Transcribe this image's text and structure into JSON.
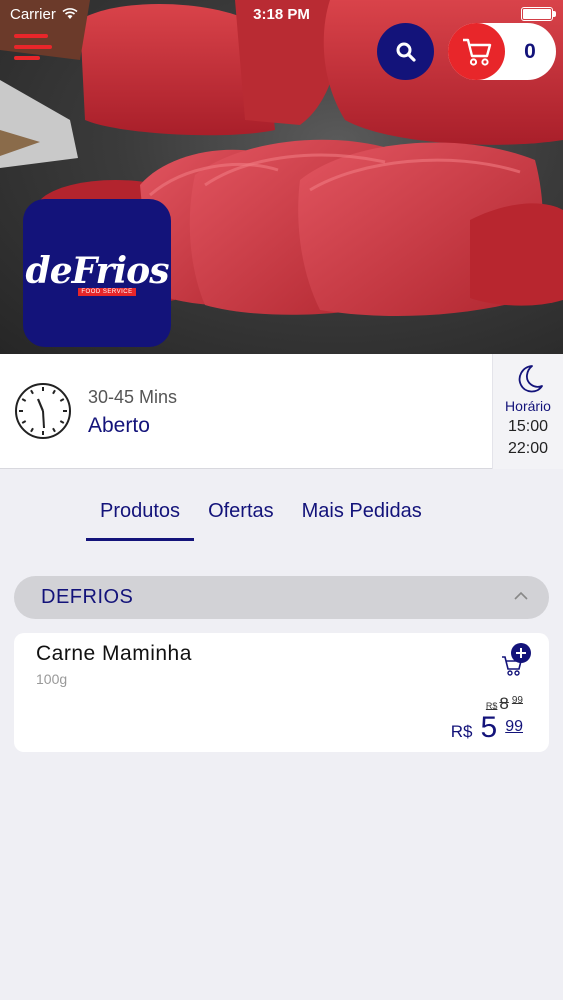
{
  "status_bar": {
    "carrier": "Carrier",
    "time": "3:18 PM"
  },
  "header": {
    "cart_count": "0"
  },
  "store": {
    "logo_text": "deFrios",
    "logo_subtitle": "FOOD SERVICE",
    "delivery_time": "30-45 Mins",
    "status": "Aberto",
    "hours_label": "Horário",
    "open_time": "15:00",
    "close_time": "22:00"
  },
  "tabs": [
    {
      "label": "Produtos",
      "active": true
    },
    {
      "label": "Ofertas",
      "active": false
    },
    {
      "label": "Mais Pedidas",
      "active": false
    }
  ],
  "category": {
    "name": "DEFRIOS"
  },
  "products": [
    {
      "name": "Carne Maminha",
      "weight": "100g",
      "old_price": {
        "currency": "R$",
        "integer": "8",
        "decimals": "99"
      },
      "price": {
        "currency": "R$",
        "integer": "5",
        "decimals": "99"
      }
    }
  ],
  "colors": {
    "brand_navy": "#13137a",
    "brand_red": "#e8262a",
    "background": "#efeff4"
  },
  "icons": [
    "menu-icon",
    "search-icon",
    "cart-icon",
    "clock-icon",
    "moon-icon",
    "chevron-up-icon",
    "add-to-cart-icon"
  ]
}
